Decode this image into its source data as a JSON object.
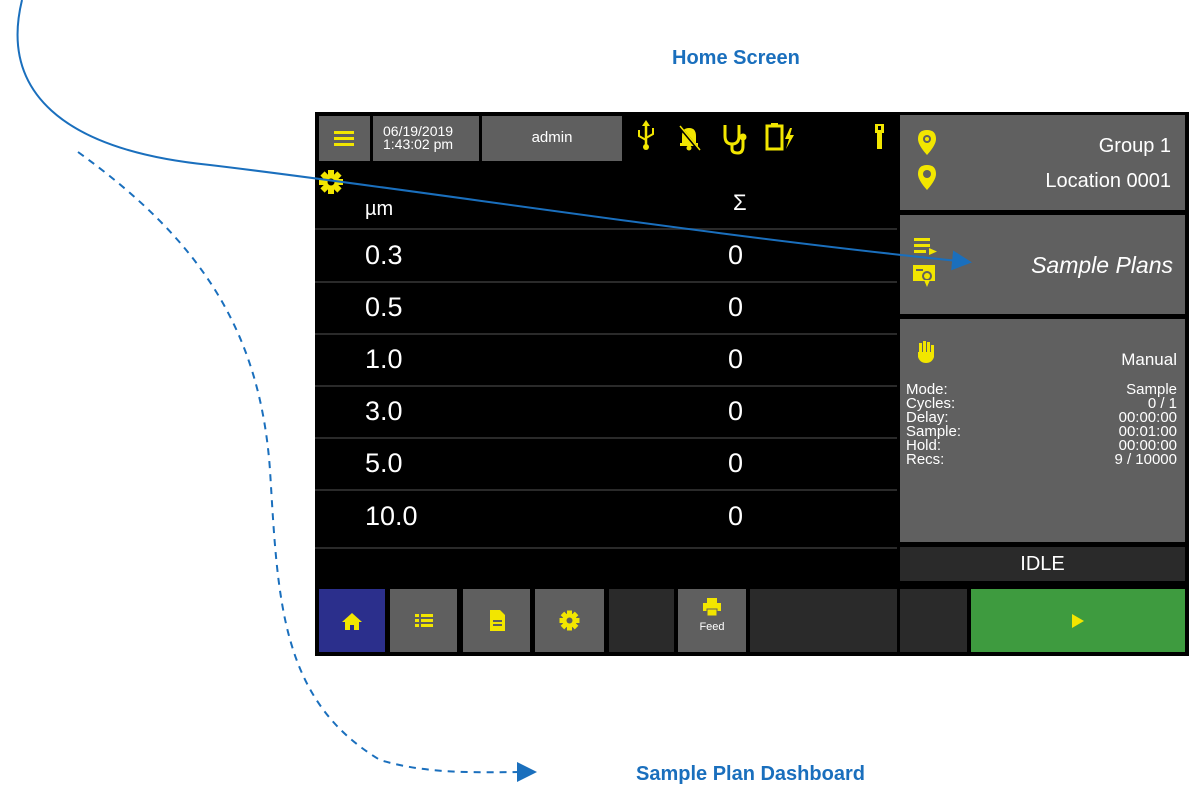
{
  "captions": {
    "home_screen": "Home Screen",
    "sample_plan_dashboard": "Sample Plan Dashboard"
  },
  "top_bar": {
    "date": "06/19/2019",
    "time": "1:43:02 pm",
    "user": "admin",
    "icons": [
      "menu-icon",
      "usb-icon",
      "alarm-off-icon",
      "stethoscope-icon",
      "battery-charging-icon",
      "flashlight-icon"
    ]
  },
  "table": {
    "header_size": "µm",
    "header_sum": "Σ",
    "rows": [
      {
        "size": "0.3",
        "value": "0"
      },
      {
        "size": "0.5",
        "value": "0"
      },
      {
        "size": "1.0",
        "value": "0"
      },
      {
        "size": "3.0",
        "value": "0"
      },
      {
        "size": "5.0",
        "value": "0"
      },
      {
        "size": "10.0",
        "value": "0"
      }
    ]
  },
  "location_panel": {
    "group": "Group 1",
    "location": "Location 0001"
  },
  "sample_plans": {
    "label": "Sample Plans"
  },
  "mode_panel": {
    "mode_type": "Manual",
    "rows": [
      {
        "label": "Mode:",
        "value": "Sample"
      },
      {
        "label": "Cycles:",
        "value": "0 / 1"
      },
      {
        "label": "Delay:",
        "value": "00:00:00"
      },
      {
        "label": "Sample:",
        "value": "00:01:00"
      },
      {
        "label": "Hold:",
        "value": "00:00:00"
      },
      {
        "label": "Recs:",
        "value": "9 / 10000"
      }
    ]
  },
  "status": {
    "text": "IDLE"
  },
  "bottom_bar": {
    "feed_label": "Feed"
  },
  "colors": {
    "accent_yellow": "#f2e600",
    "home_blue": "#2b2f8c",
    "start_green": "#3e9b3f",
    "panel_grey": "#606060",
    "caption_blue": "#1a6fbd"
  }
}
